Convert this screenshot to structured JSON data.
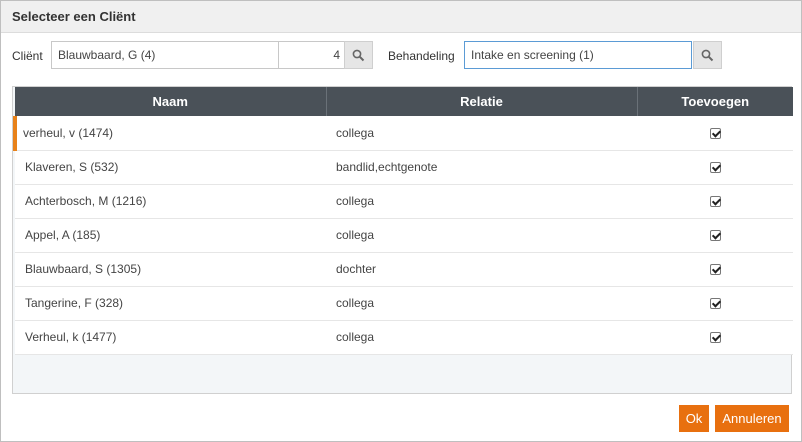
{
  "dialog": {
    "title": "Selecteer een Cliënt"
  },
  "form": {
    "client_label": "Cliënt",
    "client_value": "Blauwbaard, G (4)",
    "client_number": "4",
    "behandeling_label": "Behandeling",
    "behandeling_value": "Intake en screening (1)"
  },
  "table": {
    "columns": [
      "Naam",
      "Relatie",
      "Toevoegen"
    ],
    "rows": [
      {
        "naam": "verheul, v (1474)",
        "relatie": "collega",
        "toevoegen": true
      },
      {
        "naam": "Klaveren, S (532)",
        "relatie": "bandlid,echtgenote",
        "toevoegen": true
      },
      {
        "naam": "Achterbosch, M (1216)",
        "relatie": "collega",
        "toevoegen": true
      },
      {
        "naam": "Appel, A (185)",
        "relatie": "collega",
        "toevoegen": true
      },
      {
        "naam": "Blauwbaard, S (1305)",
        "relatie": "dochter",
        "toevoegen": true
      },
      {
        "naam": "Tangerine, F (328)",
        "relatie": "collega",
        "toevoegen": true
      },
      {
        "naam": "Verheul, k (1477)",
        "relatie": "collega",
        "toevoegen": true
      }
    ]
  },
  "buttons": {
    "ok_label": "Ok",
    "cancel_label": "Annuleren"
  },
  "icons": {
    "search": "search-icon",
    "checkbox": "checkbox-checked-icon"
  },
  "colors": {
    "accent": "#e8700f",
    "header": "#4a5158",
    "focus": "#5b9bd5"
  }
}
